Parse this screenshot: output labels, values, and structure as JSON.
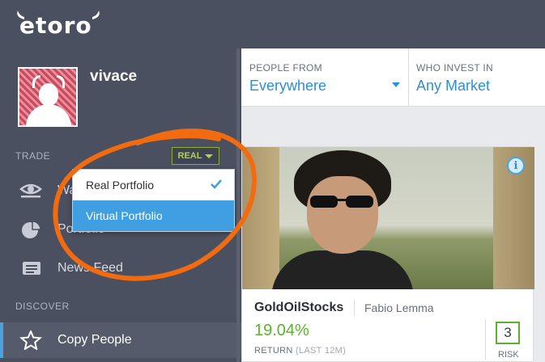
{
  "app": {
    "logo": "etoro"
  },
  "profile": {
    "username": "vivace"
  },
  "sidebar": {
    "sections": {
      "trade": "TRADE",
      "discover": "DISCOVER"
    },
    "account_mode": "REAL",
    "items": [
      {
        "label": "Watchlist",
        "icon": "eye-icon"
      },
      {
        "label": "Portfolio",
        "icon": "pie-chart-icon"
      },
      {
        "label": "News Feed",
        "icon": "news-icon"
      },
      {
        "label": "Copy People",
        "icon": "star-icon"
      }
    ]
  },
  "portfolio_dropdown": {
    "options": [
      {
        "label": "Real Portfolio",
        "checked": true
      },
      {
        "label": "Virtual Portfolio",
        "highlighted": true
      }
    ]
  },
  "filters": {
    "people_from": {
      "label": "PEOPLE FROM",
      "value": "Everywhere"
    },
    "who_invest_in": {
      "label": "WHO INVEST IN",
      "value": "Any Market"
    }
  },
  "card": {
    "username": "GoldOilStocks",
    "real_name": "Fabio Lemma",
    "return_value": "19.04%",
    "return_label": "RETURN",
    "return_period": "(LAST 12M)",
    "risk_score": "3",
    "risk_label": "RISK",
    "info_icon": "i"
  },
  "colors": {
    "accent": "#2d8fd5",
    "positive": "#59b32b",
    "annotation": "#f26b10",
    "sidebar_bg": "#4b5060"
  }
}
